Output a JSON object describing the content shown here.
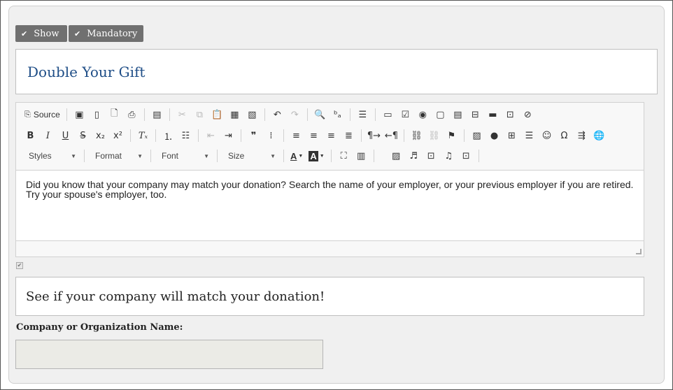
{
  "toggles": {
    "show_label": "Show",
    "mandatory_label": "Mandatory"
  },
  "title": "Double Your Gift",
  "editor": {
    "source_label": "Source",
    "styles_label": "Styles",
    "format_label": "Format",
    "font_label": "Font",
    "size_label": "Size",
    "content": "Did you know that your company may match your donation? Search the name of your employer, or your previous employer if you are retired. Try your spouse's employer, too."
  },
  "heading": "See if your company will match your donation!",
  "field": {
    "label": "Company or Organization Name:",
    "value": ""
  },
  "colors": {
    "title": "#1f4e87",
    "toggle_bg": "#707070",
    "input_bg": "#ebebe6"
  }
}
